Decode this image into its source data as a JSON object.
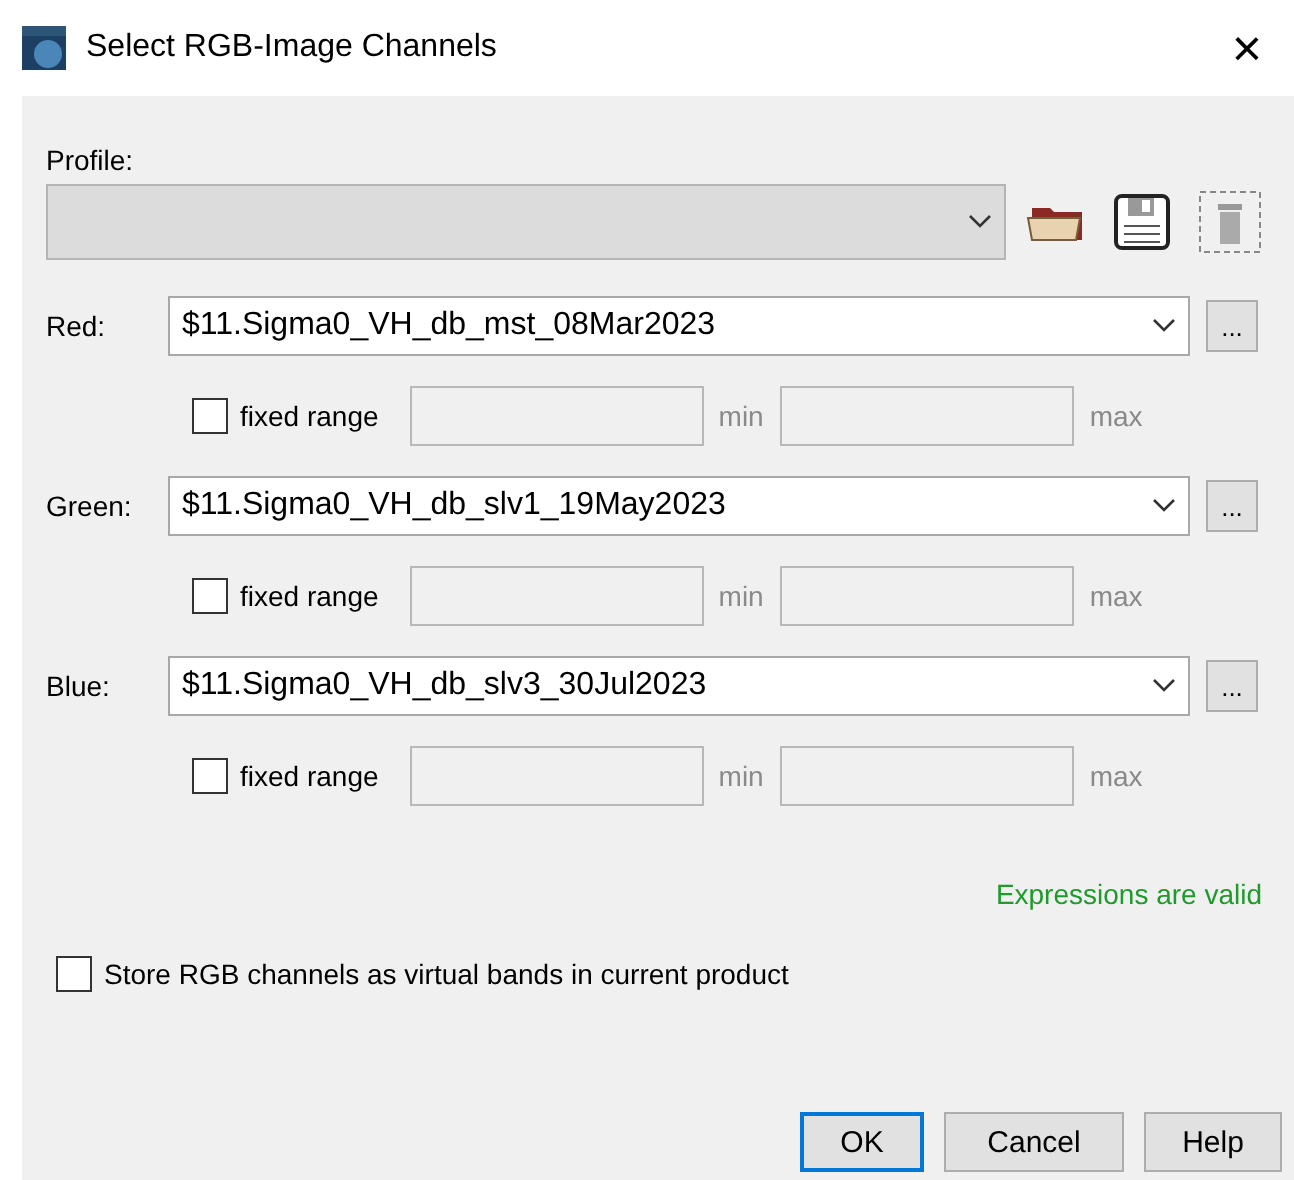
{
  "window": {
    "title": "Select RGB-Image Channels",
    "close": "×"
  },
  "profile": {
    "label": "Profile:",
    "disabled": true
  },
  "channels": [
    {
      "label": "Red:",
      "value": "$11.Sigma0_VH_db_mst_08Mar2023",
      "more": "...",
      "fixed_range": {
        "label": "fixed range",
        "checked": false
      },
      "min_label": "min",
      "max_label": "max"
    },
    {
      "label": "Green:",
      "value": "$11.Sigma0_VH_db_slv1_19May2023",
      "more": "...",
      "fixed_range": {
        "label": "fixed range",
        "checked": false
      },
      "min_label": "min",
      "max_label": "max"
    },
    {
      "label": "Blue:",
      "value": "$11.Sigma0_VH_db_slv3_30Jul2023",
      "more": "...",
      "fixed_range": {
        "label": "fixed range",
        "checked": false
      },
      "min_label": "min",
      "max_label": "max"
    }
  ],
  "status": "Expressions are valid",
  "store_virtual": {
    "label": "Store RGB channels as virtual bands in current product",
    "checked": false
  },
  "buttons": [
    {
      "label": "OK",
      "default": true
    },
    {
      "label": "Cancel",
      "default": false
    },
    {
      "label": "Help",
      "default": false
    }
  ]
}
